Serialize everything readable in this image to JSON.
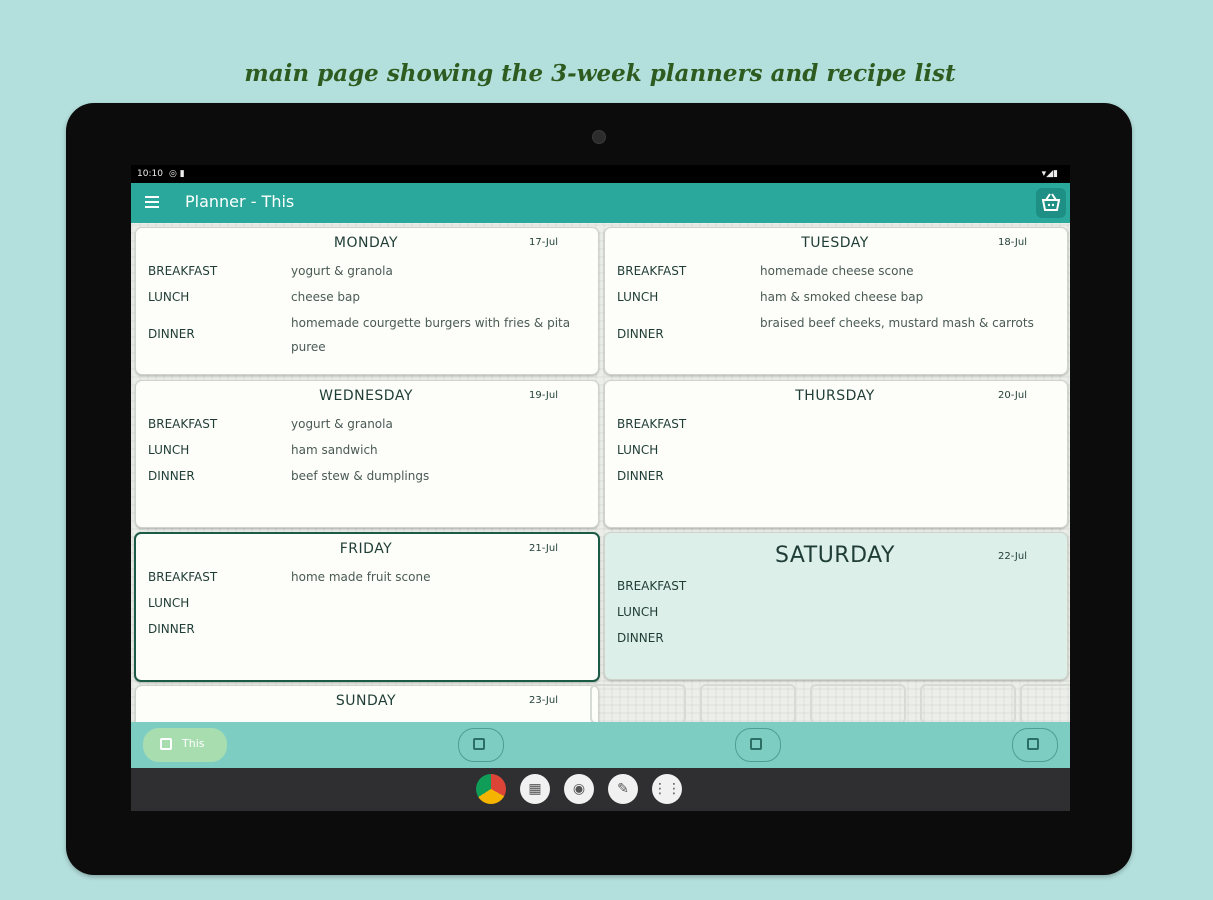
{
  "caption": "main page showing the 3-week planners and recipe list",
  "status": {
    "time": "10:10",
    "left_icons": "◎ ▮",
    "right_icons": "▾◢▮"
  },
  "appbar": {
    "title": "Planner - This",
    "menu_icon": "menu-icon",
    "basket_icon": "basket-icon"
  },
  "labels": {
    "breakfast": "BREAKFAST",
    "lunch": "LUNCH",
    "dinner": "DINNER"
  },
  "days": [
    {
      "day": "MONDAY",
      "date": "17-Jul",
      "breakfast": "yogurt & granola",
      "lunch": "cheese bap",
      "dinner": "homemade courgette burgers with fries & pita puree"
    },
    {
      "day": "TUESDAY",
      "date": "18-Jul",
      "breakfast": "homemade cheese scone",
      "lunch": "ham & smoked cheese bap",
      "dinner": "braised beef cheeks, mustard mash & carrots"
    },
    {
      "day": "WEDNESDAY",
      "date": "19-Jul",
      "breakfast": "yogurt & granola",
      "lunch": "ham sandwich",
      "dinner": "beef stew & dumplings"
    },
    {
      "day": "THURSDAY",
      "date": "20-Jul",
      "breakfast": "",
      "lunch": "",
      "dinner": ""
    },
    {
      "day": "FRIDAY",
      "date": "21-Jul",
      "breakfast": "home made fruit scone",
      "lunch": "",
      "dinner": ""
    },
    {
      "day": "SATURDAY",
      "date": "22-Jul",
      "breakfast": "",
      "lunch": "",
      "dinner": ""
    },
    {
      "day": "SUNDAY",
      "date": "23-Jul"
    }
  ],
  "bottom_nav": {
    "active_label": "This"
  },
  "colors": {
    "accent": "#2aa89b",
    "bottom_bar": "#7ecdc3",
    "background": "#b3dfdc",
    "caption": "#2e5b1f"
  }
}
